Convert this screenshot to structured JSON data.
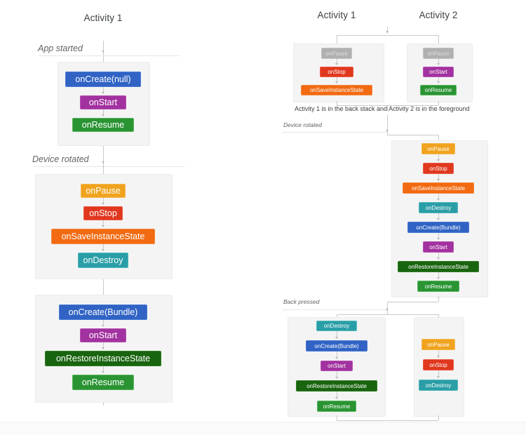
{
  "left_diagram": {
    "title": "Activity 1",
    "events": [
      {
        "label": "App started"
      },
      {
        "label": "Device rotated"
      }
    ],
    "groups": [
      {
        "name": "app-started-group",
        "steps": [
          {
            "label": "onCreate(null)",
            "kind": "create"
          },
          {
            "label": "onStart",
            "kind": "start"
          },
          {
            "label": "onResume",
            "kind": "resume"
          }
        ]
      },
      {
        "name": "device-rotated-teardown-group",
        "steps": [
          {
            "label": "onPause",
            "kind": "pause"
          },
          {
            "label": "onStop",
            "kind": "stop"
          },
          {
            "label": "onSaveInstanceState",
            "kind": "save"
          },
          {
            "label": "onDestroy",
            "kind": "destroy"
          }
        ]
      },
      {
        "name": "device-rotated-rebuild-group",
        "steps": [
          {
            "label": "onCreate(Bundle)",
            "kind": "create"
          },
          {
            "label": "onStart",
            "kind": "start"
          },
          {
            "label": "onRestoreInstanceState",
            "kind": "restore"
          },
          {
            "label": "onResume",
            "kind": "resume"
          }
        ]
      }
    ]
  },
  "right_diagram": {
    "titles": {
      "activity_1": "Activity 1",
      "activity_2": "Activity 2"
    },
    "caption": "Activity 1 is in the back stack and Activity 2 is in the foreground",
    "events": [
      {
        "label": "Device rotated"
      },
      {
        "label": "Back pressed"
      }
    ],
    "top_activity_1": {
      "steps": [
        {
          "label": "onPause",
          "kind": "faded"
        },
        {
          "label": "onStop",
          "kind": "stop"
        },
        {
          "label": "onSaveInstanceState",
          "kind": "save"
        }
      ]
    },
    "top_activity_2": {
      "steps": [
        {
          "label": "onPause",
          "kind": "faded"
        },
        {
          "label": "onStart",
          "kind": "start"
        },
        {
          "label": "onResume",
          "kind": "resume"
        }
      ]
    },
    "rotated_activity_2": {
      "steps": [
        {
          "label": "onPause",
          "kind": "pause"
        },
        {
          "label": "onStop",
          "kind": "stop"
        },
        {
          "label": "onSaveInstanceState",
          "kind": "save"
        },
        {
          "label": "onDestroy",
          "kind": "destroy"
        },
        {
          "label": "onCreate(Bundle)",
          "kind": "create"
        },
        {
          "label": "onStart",
          "kind": "start"
        },
        {
          "label": "onRestoreInstanceState",
          "kind": "restore"
        },
        {
          "label": "onResume",
          "kind": "resume"
        }
      ]
    },
    "back_activity_1": {
      "steps": [
        {
          "label": "onDestroy",
          "kind": "destroy"
        },
        {
          "label": "onCreate(Bundle)",
          "kind": "create"
        },
        {
          "label": "onStart",
          "kind": "start"
        },
        {
          "label": "onRestoreInstanceState",
          "kind": "restore"
        },
        {
          "label": "onResume",
          "kind": "resume"
        }
      ]
    },
    "back_activity_2": {
      "steps": [
        {
          "label": "onPause",
          "kind": "pause"
        },
        {
          "label": "onStop",
          "kind": "stop"
        },
        {
          "label": "onDestroy",
          "kind": "destroy"
        }
      ]
    }
  },
  "colors": {
    "create": "#3063c4",
    "create_border": "#4a7ad6",
    "start": "#a2329f",
    "start_border": "#b74fb4",
    "resume": "#2a9433",
    "resume_border": "#56b45c",
    "pause": "#f0a31e",
    "pause_border": "#f5b64c",
    "stop": "#e0381f",
    "stop_border": "#ea5a42",
    "save": "#f26a12",
    "save_border": "#f5873c",
    "destroy": "#2a9ea6",
    "destroy_border": "#4fb8bd",
    "restore": "#19640f",
    "restore_border": "#2f7d24",
    "faded": "#b0b0b0",
    "faded_border": "#c2c2c2",
    "panel_bg": "#f4f4f4",
    "line": "#c9c9c9",
    "label_text": "#5f6368",
    "title_text": "#3c4043"
  }
}
